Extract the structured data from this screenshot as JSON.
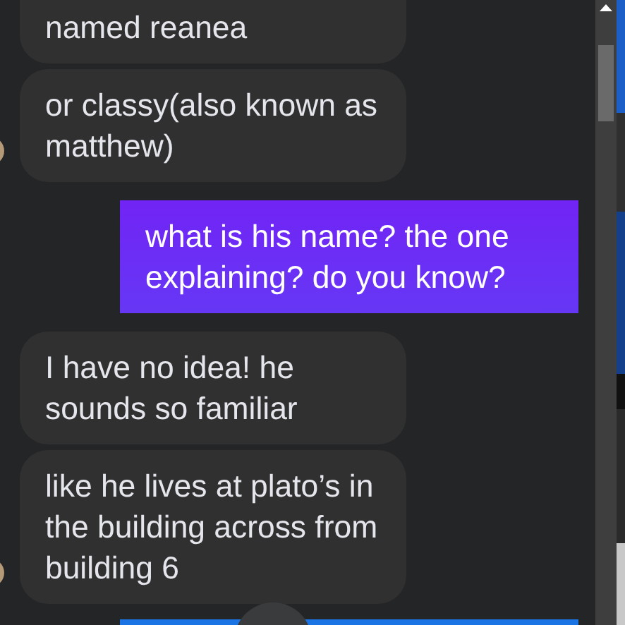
{
  "messages": [
    {
      "kind": "received",
      "text": "named reanea",
      "avatar": false
    },
    {
      "kind": "received",
      "text": "or classy(also known as matthew)",
      "avatar": true
    },
    {
      "kind": "sent",
      "text": "what is his name? the one explaining? do you know?"
    },
    {
      "kind": "received",
      "text": "I have no idea! he sounds so familiar",
      "avatar": false
    },
    {
      "kind": "received",
      "text": "like he lives at plato’s in the building across from building 6",
      "avatar": true
    },
    {
      "kind": "sent_partial"
    }
  ]
}
